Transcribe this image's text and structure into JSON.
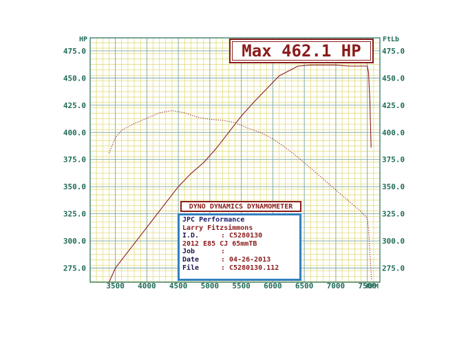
{
  "max_label": "Max 462.1 HP",
  "dyno_title": "DYNO DYNAMICS DYNAMOMETER",
  "info": {
    "company": "JPC Performance",
    "customer": "Larry Fitzsimmons",
    "id_label": "I.D.",
    "id_value": ": C5280130",
    "vehicle": "2012 E85 CJ 65mmTB",
    "job_label": "Job",
    "job_value": ":",
    "date_label": "Date",
    "date_value": ": 04-26-2013",
    "file_label": "File",
    "file_value": ": C5280130.112"
  },
  "colors": {
    "grid_minor": "#ddd56a",
    "grid_major": "#7aa7a4",
    "hp_line": "#8b1a1a",
    "torque_line": "#8b1a1a",
    "frame": "#1f6b57",
    "info_border": "#2f7fbf"
  },
  "chart_data": {
    "type": "line",
    "left_unit": "HP",
    "right_unit": "FtLb",
    "x_unit": "RPM",
    "xlim": [
      3100,
      7700
    ],
    "ylim": [
      262,
      487
    ],
    "x_ticks": [
      "3500",
      "4000",
      "4500",
      "5000",
      "5500",
      "6000",
      "6500",
      "7000",
      "7500"
    ],
    "x_tick_values": [
      3500,
      4000,
      4500,
      5000,
      5500,
      6000,
      6500,
      7000,
      7500
    ],
    "y_ticks": [
      "475.0",
      "450.0",
      "425.0",
      "400.0",
      "375.0",
      "350.0",
      "325.0",
      "300.0",
      "275.0"
    ],
    "y_tick_values": [
      475,
      450,
      425,
      400,
      375,
      350,
      325,
      300,
      275
    ],
    "series": [
      {
        "style": "solid",
        "x": [
          3400,
          3500,
          3700,
          3900,
          4100,
          4300,
          4500,
          4700,
          4900,
          5100,
          5300,
          5500,
          5700,
          5900,
          6100,
          6300,
          6400,
          6600,
          6800,
          7000,
          7200,
          7400,
          7450,
          7500,
          7520,
          7540,
          7560
        ],
        "y": [
          262,
          275,
          290,
          305,
          320,
          335,
          350,
          362,
          372,
          385,
          400,
          415,
          428,
          440,
          452,
          458,
          461,
          462,
          462,
          462,
          461,
          461,
          461,
          461,
          455,
          430,
          386
        ]
      },
      {
        "style": "dotted",
        "x": [
          3400,
          3500,
          3600,
          3800,
          4000,
          4200,
          4400,
          4600,
          4800,
          5000,
          5200,
          5400,
          5600,
          5800,
          6000,
          6200,
          6400,
          6600,
          6800,
          7000,
          7200,
          7400,
          7500,
          7520,
          7540,
          7560,
          7570
        ],
        "y": [
          381,
          395,
          402,
          408,
          413,
          418,
          420,
          418,
          414,
          412,
          411,
          409,
          404,
          400,
          394,
          386,
          377,
          367,
          357,
          347,
          337,
          327,
          321,
          310,
          290,
          270,
          264
        ]
      }
    ]
  }
}
